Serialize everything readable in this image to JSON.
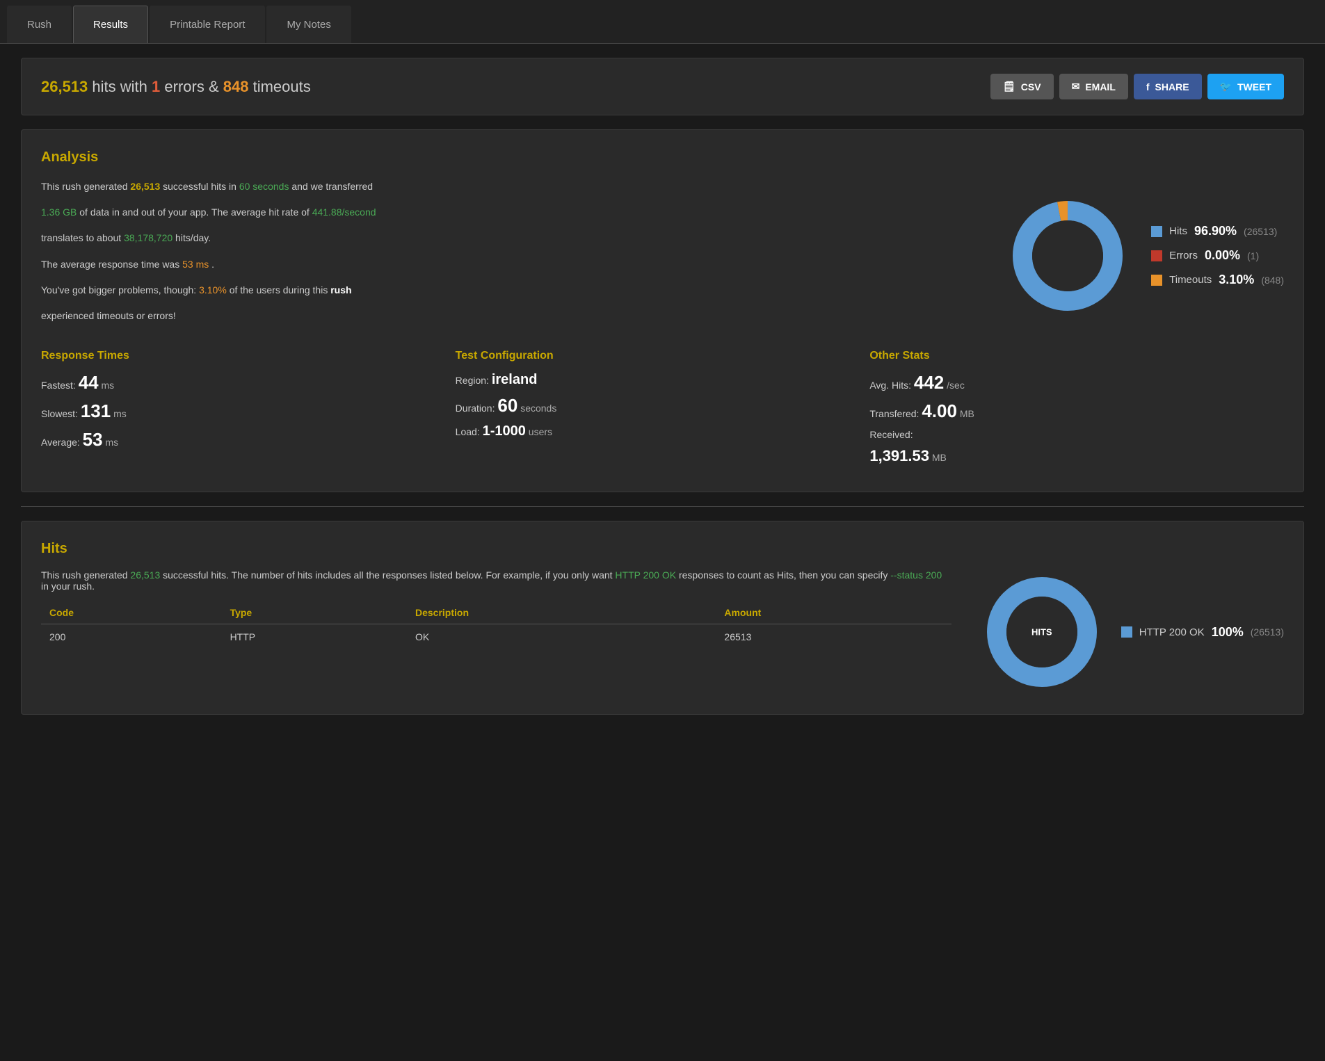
{
  "tabs": [
    {
      "id": "rush",
      "label": "Rush",
      "active": false
    },
    {
      "id": "results",
      "label": "Results",
      "active": true
    },
    {
      "id": "printable",
      "label": "Printable Report",
      "active": false
    },
    {
      "id": "notes",
      "label": "My Notes",
      "active": false
    }
  ],
  "summary": {
    "hits": "26,513",
    "hits_raw": "26513",
    "errors": "1",
    "timeouts": "848",
    "text_pre": "",
    "text_mid1": " hits with ",
    "text_mid2": " errors & ",
    "text_mid3": " timeouts"
  },
  "actions": {
    "csv": "CSV",
    "email": "EMAIL",
    "share": "SHARE",
    "tweet": "TWEET"
  },
  "analysis": {
    "title": "Analysis",
    "p1_pre": "This rush generated ",
    "p1_hits": "26,513",
    "p1_mid": " successful hits in ",
    "p1_duration": "60 seconds",
    "p1_post": " and we transferred",
    "p2_data": "1.36 GB",
    "p2_mid": " of data in and out of your app. The average hit rate of ",
    "p2_rate": "441.88/second",
    "p2_post": "",
    "p3": "translates to about ",
    "p3_hits": "38,178,720",
    "p3_post": " hits/day.",
    "p4_pre": "The average response time was ",
    "p4_ms": "53 ms",
    "p4_post": ".",
    "p5_pre": "You've got bigger problems, though: ",
    "p5_pct": "3.10%",
    "p5_mid": " of the users during this ",
    "p5_bold": "rush",
    "p5_post": "",
    "p5_last": "experienced timeouts or errors!"
  },
  "donut": {
    "hits_pct": 96.9,
    "errors_pct": 0.0,
    "timeouts_pct": 3.1,
    "hits_label": "Hits",
    "errors_label": "Errors",
    "timeouts_label": "Timeouts",
    "hits_display": "96.90%",
    "errors_display": "0.00%",
    "timeouts_display": "3.10%",
    "hits_count": "(26513)",
    "errors_count": "(1)",
    "timeouts_count": "(848)",
    "hits_color": "#5b9bd5",
    "errors_color": "#c0392b",
    "timeouts_color": "#e8922a"
  },
  "response_times": {
    "title": "Response Times",
    "fastest_label": "Fastest:",
    "fastest_val": "44",
    "fastest_unit": "ms",
    "slowest_label": "Slowest:",
    "slowest_val": "131",
    "slowest_unit": "ms",
    "average_label": "Average:",
    "average_val": "53",
    "average_unit": "ms"
  },
  "test_config": {
    "title": "Test Configuration",
    "region_label": "Region:",
    "region_val": "ireland",
    "duration_label": "Duration:",
    "duration_val": "60",
    "duration_unit": "seconds",
    "load_label": "Load:",
    "load_val": "1-1000",
    "load_unit": "users"
  },
  "other_stats": {
    "title": "Other Stats",
    "avg_hits_label": "Avg. Hits:",
    "avg_hits_val": "442",
    "avg_hits_unit": "/sec",
    "transferred_label": "Transfered:",
    "transferred_val": "4.00",
    "transferred_unit": "MB",
    "received_label": "Received:",
    "received_val": "1,391.53",
    "received_unit": "MB"
  },
  "hits_section": {
    "title": "Hits",
    "p1_pre": "This rush generated ",
    "p1_hits": "26,513",
    "p1_post": " successful hits. The number of hits includes all the responses listed below. For example, if you only want ",
    "p1_link": "HTTP 200 OK",
    "p1_post2": " responses to count as Hits, then you can specify ",
    "p1_cmd": "--status 200",
    "p1_post3": " in your rush.",
    "table": {
      "col_code": "Code",
      "col_type": "Type",
      "col_desc": "Description",
      "col_amount": "Amount",
      "rows": [
        {
          "code": "200",
          "type": "HTTP",
          "desc": "OK",
          "amount": "26513"
        }
      ]
    }
  },
  "hits_donut": {
    "label": "HITS",
    "legend_label": "HTTP 200 OK",
    "legend_pct": "100%",
    "legend_count": "(26513)",
    "color": "#5b9bd5"
  }
}
